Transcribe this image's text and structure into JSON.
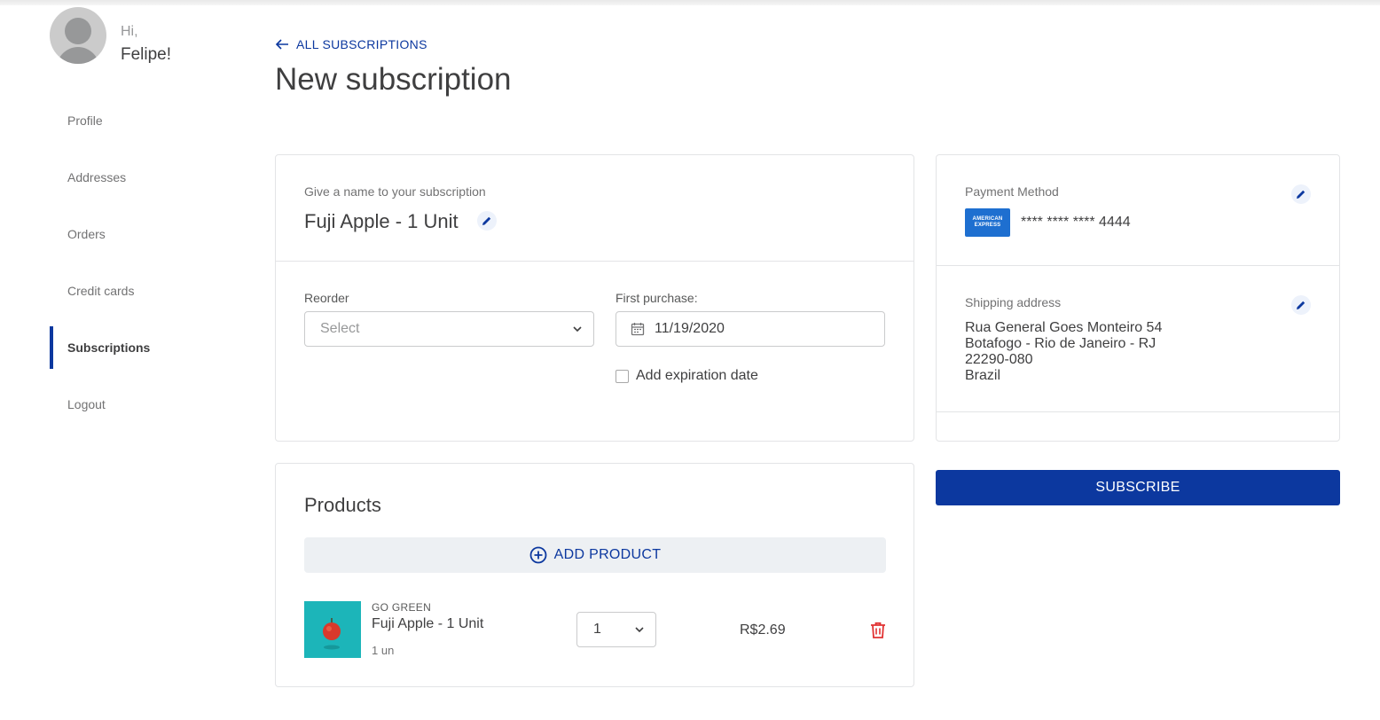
{
  "greeting": {
    "hi": "Hi,",
    "name": "Felipe!"
  },
  "sidebar": {
    "items": [
      {
        "label": "Profile",
        "active": false
      },
      {
        "label": "Addresses",
        "active": false
      },
      {
        "label": "Orders",
        "active": false
      },
      {
        "label": "Credit cards",
        "active": false
      },
      {
        "label": "Subscriptions",
        "active": true
      },
      {
        "label": "Logout",
        "active": false
      }
    ]
  },
  "header": {
    "back_label": "ALL SUBSCRIPTIONS",
    "title": "New subscription"
  },
  "subscription": {
    "name_label": "Give a name to your subscription",
    "name_value": "Fuji Apple - 1 Unit",
    "reorder_label": "Reorder",
    "reorder_placeholder": "Select",
    "first_purchase_label": "First purchase:",
    "first_purchase_value": "11/19/2020",
    "expiration_label": "Add expiration date",
    "expiration_checked": false
  },
  "products": {
    "title": "Products",
    "add_label": "ADD PRODUCT",
    "items": [
      {
        "brand": "GO GREEN",
        "name": "Fuji Apple - 1 Unit",
        "unit": "1 un",
        "quantity": "1",
        "price": "R$2.69"
      }
    ]
  },
  "payment": {
    "label": "Payment Method",
    "brand_line1": "AMERICAN",
    "brand_line2": "EXPRESS",
    "card_number": "**** **** **** 4444"
  },
  "shipping": {
    "label": "Shipping address",
    "line1": "Rua General Goes Monteiro 54",
    "line2": "Botafogo - Rio de Janeiro - RJ",
    "line3": "22290-080",
    "line4": "Brazil"
  },
  "actions": {
    "subscribe_label": "SUBSCRIBE"
  },
  "colors": {
    "primary": "#0c389f",
    "danger": "#e13232",
    "card_border": "#e3e4e6",
    "amex": "#1e6fd0",
    "product_bg": "#1cb5b9"
  }
}
